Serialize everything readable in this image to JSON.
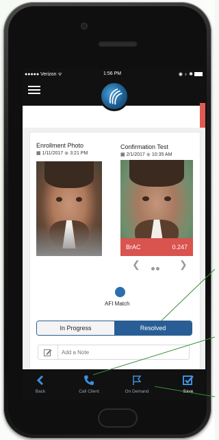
{
  "status_bar": {
    "carrier": "●●●●● Verizon ᯤ",
    "time": "1:56 PM",
    "right": "◉ ♁ ✱"
  },
  "enrollment": {
    "title": "Enrollment Photo",
    "date": "1/11/2017",
    "time": "3:21 PM"
  },
  "confirmation": {
    "title": "Confirmation Test",
    "date": "2/1/2017",
    "time": "10:35 AM",
    "brac_label": "BrAC",
    "brac_value": "0.247"
  },
  "carousel": {
    "prev": "❮",
    "next": "❯"
  },
  "afi": {
    "label": "AFI Match"
  },
  "status_toggle": {
    "in_progress": "In Progress",
    "resolved": "Resolved",
    "selected": "Resolved"
  },
  "note": {
    "placeholder": "Add a Note"
  },
  "tabbar": {
    "back": "Back",
    "call": "Call Client",
    "on_demand": "On Demand",
    "save": "Save"
  },
  "colors": {
    "accent": "#285e95",
    "brac_red": "#d9534f",
    "callout_green": "#3a8a3a"
  }
}
